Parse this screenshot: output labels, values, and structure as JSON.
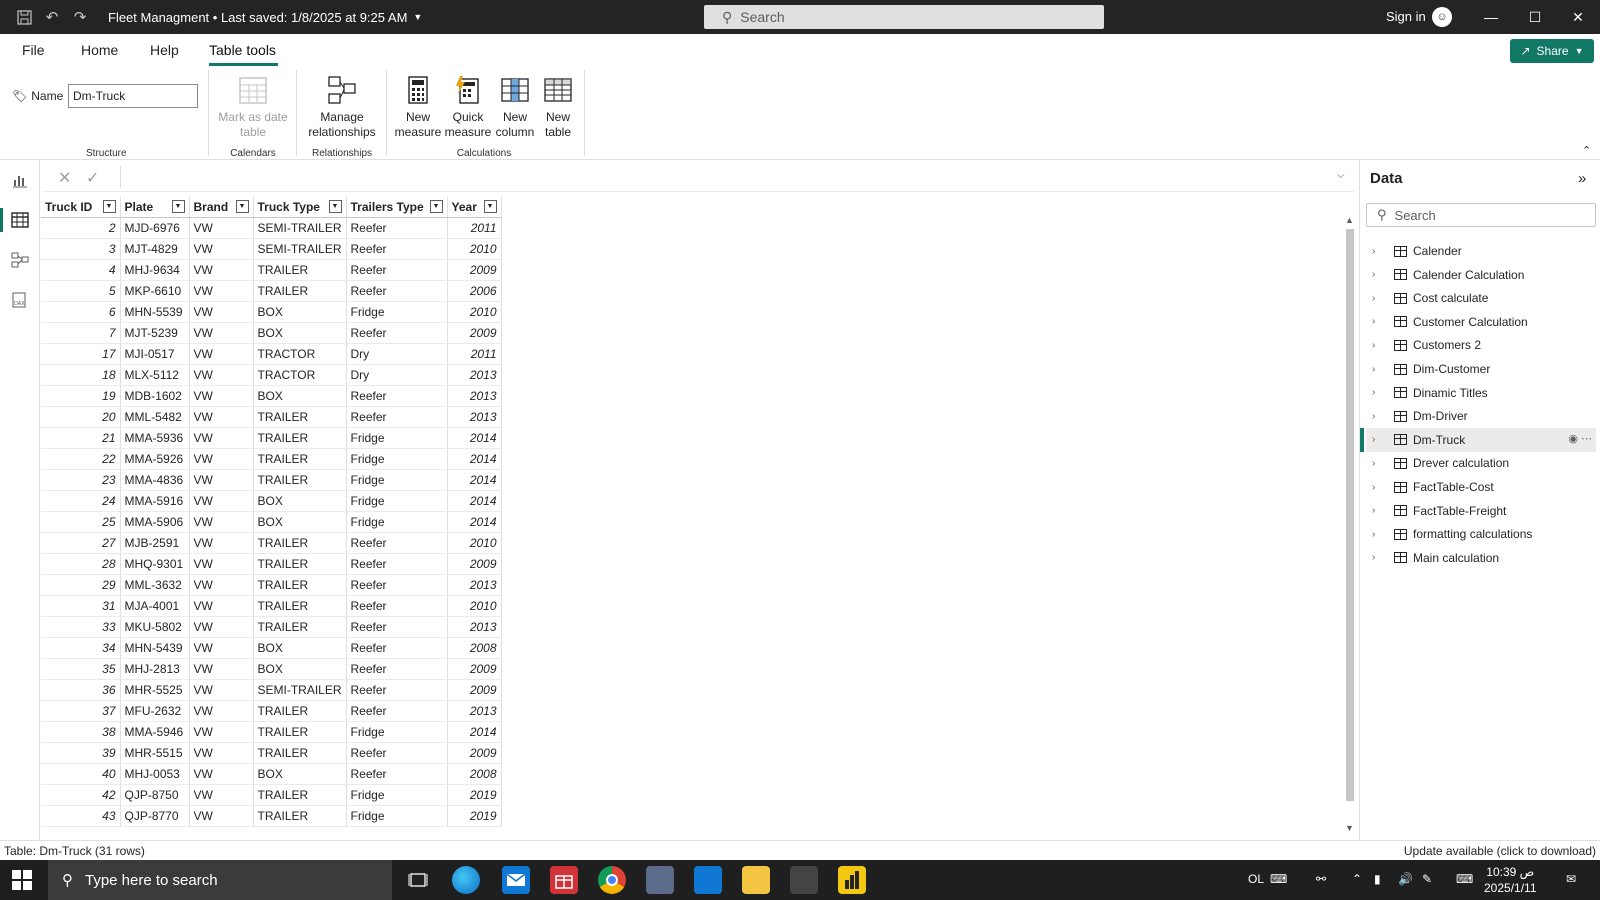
{
  "titlebar": {
    "title": "Fleet Managment • Last saved: 1/8/2025 at 9:25 AM",
    "search_placeholder": "Search",
    "sign_in": "Sign in"
  },
  "ribbon": {
    "tabs": [
      "File",
      "Home",
      "Help",
      "Table tools"
    ],
    "active_tab": "Table tools",
    "share_label": "Share",
    "name_label": "Name",
    "name_value": "Dm-Truck",
    "buttons": {
      "mark_date_1": "Mark as date",
      "mark_date_2": "table",
      "manage_rel_1": "Manage",
      "manage_rel_2": "relationships",
      "new_measure_1": "New",
      "new_measure_2": "measure",
      "quick_measure_1": "Quick",
      "quick_measure_2": "measure",
      "new_column_1": "New",
      "new_column_2": "column",
      "new_table_1": "New",
      "new_table_2": "table"
    },
    "groups": [
      "Structure",
      "Calendars",
      "Relationships",
      "Calculations"
    ]
  },
  "table": {
    "columns": [
      "Truck ID",
      "Plate",
      "Brand",
      "Truck Type",
      "Trailers Type",
      "Year"
    ],
    "rows": [
      [
        "2",
        "MJD-6976",
        "VW",
        "SEMI-TRAILER",
        "Reefer",
        "2011"
      ],
      [
        "3",
        "MJT-4829",
        "VW",
        "SEMI-TRAILER",
        "Reefer",
        "2010"
      ],
      [
        "4",
        "MHJ-9634",
        "VW",
        "TRAILER",
        "Reefer",
        "2009"
      ],
      [
        "5",
        "MKP-6610",
        "VW",
        "TRAILER",
        "Reefer",
        "2006"
      ],
      [
        "6",
        "MHN-5539",
        "VW",
        "BOX",
        "Fridge",
        "2010"
      ],
      [
        "7",
        "MJT-5239",
        "VW",
        "BOX",
        "Reefer",
        "2009"
      ],
      [
        "17",
        "MJI-0517",
        "VW",
        "TRACTOR",
        "Dry",
        "2011"
      ],
      [
        "18",
        "MLX-5112",
        "VW",
        "TRACTOR",
        "Dry",
        "2013"
      ],
      [
        "19",
        "MDB-1602",
        "VW",
        "BOX",
        "Reefer",
        "2013"
      ],
      [
        "20",
        "MML-5482",
        "VW",
        "TRAILER",
        "Reefer",
        "2013"
      ],
      [
        "21",
        "MMA-5936",
        "VW",
        "TRAILER",
        "Fridge",
        "2014"
      ],
      [
        "22",
        "MMA-5926",
        "VW",
        "TRAILER",
        "Fridge",
        "2014"
      ],
      [
        "23",
        "MMA-4836",
        "VW",
        "TRAILER",
        "Fridge",
        "2014"
      ],
      [
        "24",
        "MMA-5916",
        "VW",
        "BOX",
        "Fridge",
        "2014"
      ],
      [
        "25",
        "MMA-5906",
        "VW",
        "BOX",
        "Fridge",
        "2014"
      ],
      [
        "27",
        "MJB-2591",
        "VW",
        "TRAILER",
        "Reefer",
        "2010"
      ],
      [
        "28",
        "MHQ-9301",
        "VW",
        "TRAILER",
        "Reefer",
        "2009"
      ],
      [
        "29",
        "MML-3632",
        "VW",
        "TRAILER",
        "Reefer",
        "2013"
      ],
      [
        "31",
        "MJA-4001",
        "VW",
        "TRAILER",
        "Reefer",
        "2010"
      ],
      [
        "33",
        "MKU-5802",
        "VW",
        "TRAILER",
        "Reefer",
        "2013"
      ],
      [
        "34",
        "MHN-5439",
        "VW",
        "BOX",
        "Reefer",
        "2008"
      ],
      [
        "35",
        "MHJ-2813",
        "VW",
        "BOX",
        "Reefer",
        "2009"
      ],
      [
        "36",
        "MHR-5525",
        "VW",
        "SEMI-TRAILER",
        "Reefer",
        "2009"
      ],
      [
        "37",
        "MFU-2632",
        "VW",
        "TRAILER",
        "Reefer",
        "2013"
      ],
      [
        "38",
        "MMA-5946",
        "VW",
        "TRAILER",
        "Fridge",
        "2014"
      ],
      [
        "39",
        "MHR-5515",
        "VW",
        "TRAILER",
        "Reefer",
        "2009"
      ],
      [
        "40",
        "MHJ-0053",
        "VW",
        "BOX",
        "Reefer",
        "2008"
      ],
      [
        "42",
        "QJP-8750",
        "VW",
        "TRAILER",
        "Fridge",
        "2019"
      ],
      [
        "43",
        "QJP-8770",
        "VW",
        "TRAILER",
        "Fridge",
        "2019"
      ]
    ]
  },
  "datapane": {
    "title": "Data",
    "search_placeholder": "Search",
    "selected": "Dm-Truck",
    "items": [
      "Calender",
      "Calender Calculation",
      "Cost calculate",
      "Customer Calculation",
      "Customers 2",
      "Dim-Customer",
      "Dinamic Titles",
      "Dm-Driver",
      "Dm-Truck",
      "Drever calculation",
      "FactTable-Cost",
      "FactTable-Freight",
      "formatting calculations",
      "Main calculation"
    ]
  },
  "statusbar": {
    "left": "Table: Dm-Truck (31 rows)",
    "right": "Update available (click to download)"
  },
  "taskbar": {
    "search_placeholder": "Type here to search",
    "time": "10:39 ص",
    "date": "2025/1/11",
    "lang": "OL"
  },
  "colors": {
    "accent": "#117865",
    "titlebar_bg": "#252423",
    "taskbar_bg": "#1f1f1f"
  }
}
